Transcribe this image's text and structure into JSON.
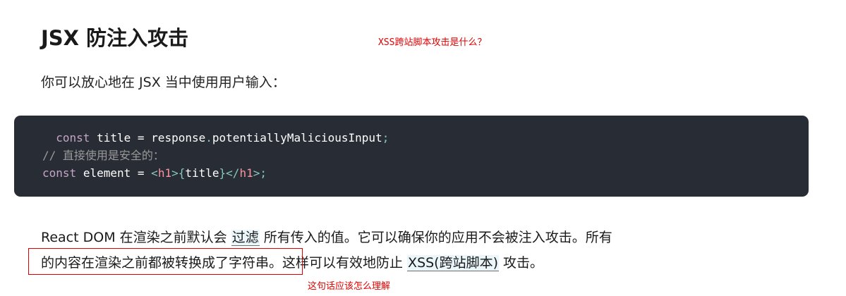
{
  "heading": "JSX 防注入攻击",
  "annotations": {
    "top_note": "XSS跨站脚本攻击是什么？",
    "bottom_note": "这句话应该怎么理解"
  },
  "intro": "你可以放心地在 JSX 当中使用用户输入：",
  "code": {
    "line1": {
      "indent": "  ",
      "kw": "const",
      "var": "title",
      "op": "=",
      "obj": "response",
      "dot": ".",
      "prop": "potentiallyMaliciousInput",
      "semi": ";"
    },
    "line2": "// 直接使用是安全的：",
    "line3": {
      "kw": "const",
      "var": "element",
      "op": "=",
      "open_lt": "<",
      "tag": "h1",
      "open_gt": ">",
      "brace_open": "{",
      "expr": "title",
      "brace_close": "}",
      "close_lt": "</",
      "close_tag": "h1",
      "close_gt": ">",
      "semi": ";"
    }
  },
  "paragraph": {
    "part1": "React DOM 在渲染之前默认会 ",
    "link1": "过滤",
    "part2": " 所有传入的值。它可以确保你的应用不会被注入攻击。所有",
    "part3": "的内容在渲染之前都被转换成了字符串。这样可以有效地防止 ",
    "link2": "XSS(跨站脚本)",
    "part4": " 攻击。"
  },
  "colors": {
    "annotation": "#e00000",
    "code_bg": "#282c34",
    "link_bg": "#ebf6fb"
  }
}
